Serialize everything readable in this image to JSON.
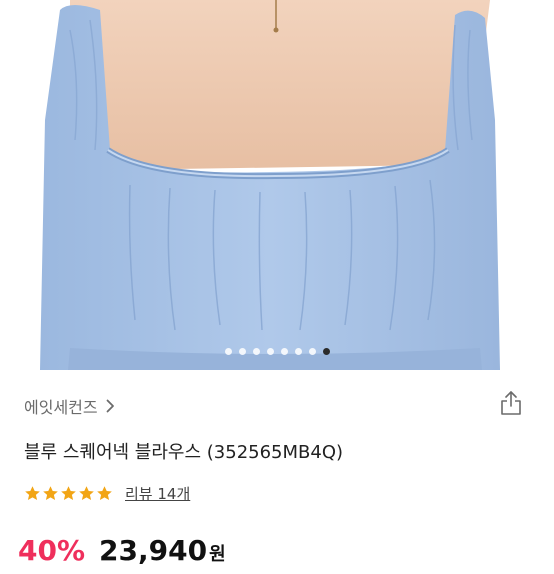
{
  "product": {
    "brand": "에잇세컨즈",
    "title": "블루 스퀘어넥 블라우스 (352565MB4Q)",
    "rating_stars": 5,
    "review_label": "리뷰 14개",
    "discount": "40%",
    "price": "23,940",
    "currency": "원"
  },
  "gallery": {
    "image_count": 8,
    "active_index": 7
  },
  "colors": {
    "discount": "#ef2f5c",
    "star": "#f2a515",
    "blouse": "#a8c3e6"
  },
  "icons": {
    "brand_chevron": "chevron-right-icon",
    "share": "share-icon"
  }
}
